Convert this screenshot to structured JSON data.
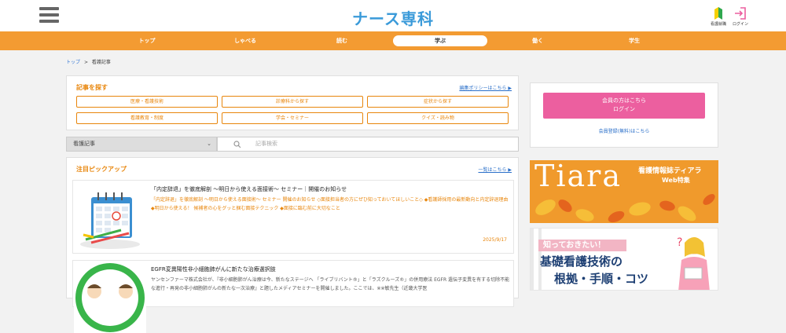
{
  "header": {
    "logo": "ナース専科",
    "beginner_label": "看護就職",
    "login_label": "ログイン"
  },
  "nav": {
    "items": [
      "トップ",
      "しゃべる",
      "読む",
      "学ぶ",
      "働く",
      "学生"
    ],
    "active_index": 3
  },
  "breadcrumb": {
    "home": "トップ",
    "separator": ">",
    "current": "看護記事"
  },
  "search_panel": {
    "title": "記事を探す",
    "policy_link": "編集ポリシーはこちら ▶",
    "categories": [
      "医療・看護技術",
      "診療科から探す",
      "症状から探す",
      "看護教育・制度",
      "学会・セミナー",
      "クイズ・読み物"
    ]
  },
  "search": {
    "select_value": "看護記事",
    "placeholder": "記事検索"
  },
  "pickup": {
    "title": "注目ピックアップ",
    "list_link": "一覧はこちら ▶",
    "articles": [
      {
        "title": "「内定辞退」を徹底解剖 ～明日から使える面接術～ セミナー｜開催のお知らせ",
        "body": "「内定辞退」を徹底解剖 ～明日から使える面接術～ セミナー 開催のお知らせ ◇面接担当者の方にぜひ知っておいてほしいこと◇ ◆看護師採用の最新動向と内定辞退理由 ◆明日から使える！ 候補者の心をグッと掴む面接テクニック ◆面接に臨む前に大切なこと",
        "date": "2025/9/17"
      },
      {
        "title": "EGFR変異陽性非小細胞肺がんに新たな治療選択肢",
        "body": "ヤンセンファーマ株式会社が、『非小細胞肺がん治療は今、新たなステージへ 「ライブリバント®」と「ラズクルーズ®」の併用療法 EGFR 遺伝子変異を有する切除不能な進行・再発の非小細胞肺がんの新たな一次治療』と題したメディアセミナーを開催しました。ここでは、※※敏先生（近畿大学医",
        "date": ""
      }
    ]
  },
  "member": {
    "button_line1": "会員の方はこちら",
    "button_line2": "ログイン",
    "register_link": "会員登録(無料)はこちら"
  },
  "banner_tiara": {
    "brand": "Tiara",
    "title": "看護情報誌ティアラ",
    "subtitle": "Web特集"
  },
  "banner_skills": {
    "line1": "知っておきたい！",
    "line2": "基礎看護技術の",
    "line3": "根拠・手順・コツ"
  },
  "colors": {
    "nav_orange": "#f39b32",
    "accent_orange": "#e8860c",
    "logo_blue": "#3a9ad9",
    "login_pink": "#ec5f9f"
  }
}
